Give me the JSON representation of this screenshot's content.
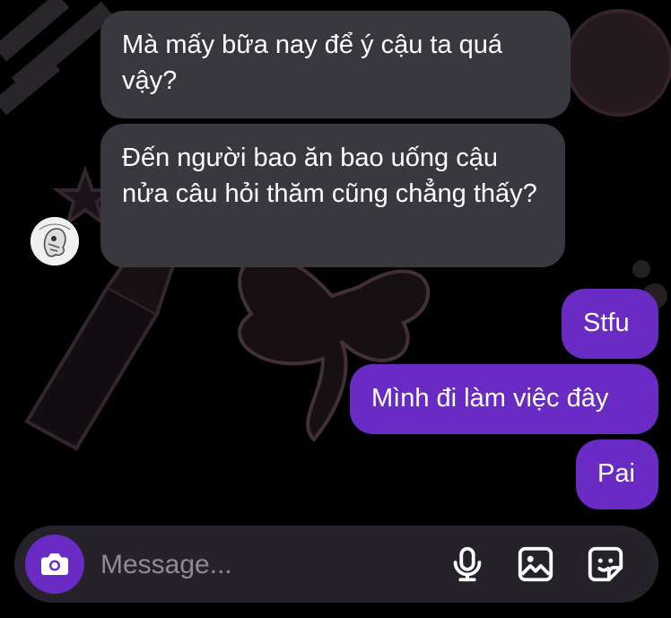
{
  "messages": [
    {
      "side": "received",
      "text": "Mà mấy bữa nay để ý cậu ta quá vậy?"
    },
    {
      "side": "received",
      "text": "Đến người bao ăn bao uống cậu nửa câu hỏi thăm cũng chẳng thấy?"
    },
    {
      "side": "sent",
      "text": "Stfu"
    },
    {
      "side": "sent",
      "text": "Mình đi làm việc đây"
    },
    {
      "side": "sent",
      "text": "Pai"
    }
  ],
  "composer": {
    "placeholder": "Message...",
    "camera_icon": "camera-icon",
    "mic_icon": "microphone-icon",
    "gallery_icon": "image-icon",
    "sticker_icon": "sticker-icon"
  },
  "colors": {
    "received_bubble": "#3a383f",
    "sent_bubble": "#6a2bc4",
    "composer_bg": "#252329",
    "background": "#000000"
  }
}
